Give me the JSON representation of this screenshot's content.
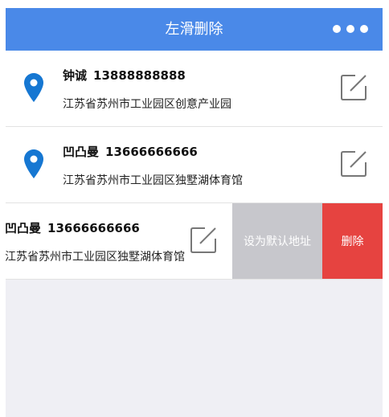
{
  "header": {
    "title": "左滑删除",
    "more_icon": "more-dots-icon",
    "background": "#4a89e8"
  },
  "addresses": [
    {
      "name": "钟诚",
      "phone": "13888888888",
      "address": "江苏省苏州市工业园区创意产业园"
    },
    {
      "name": "凹凸曼",
      "phone": "13666666666",
      "address": "江苏省苏州市工业园区独墅湖体育馆"
    },
    {
      "name": "凹凸曼",
      "phone": "13666666666",
      "address": "江苏省苏州市工业园区独墅湖体育馆"
    }
  ],
  "actions": {
    "set_default_label": "设为默认地址",
    "delete_label": "删除",
    "set_default_color": "#c7c7cc",
    "delete_color": "#e64340"
  },
  "icons": {
    "location": "location-pin-icon",
    "edit": "edit-icon"
  }
}
